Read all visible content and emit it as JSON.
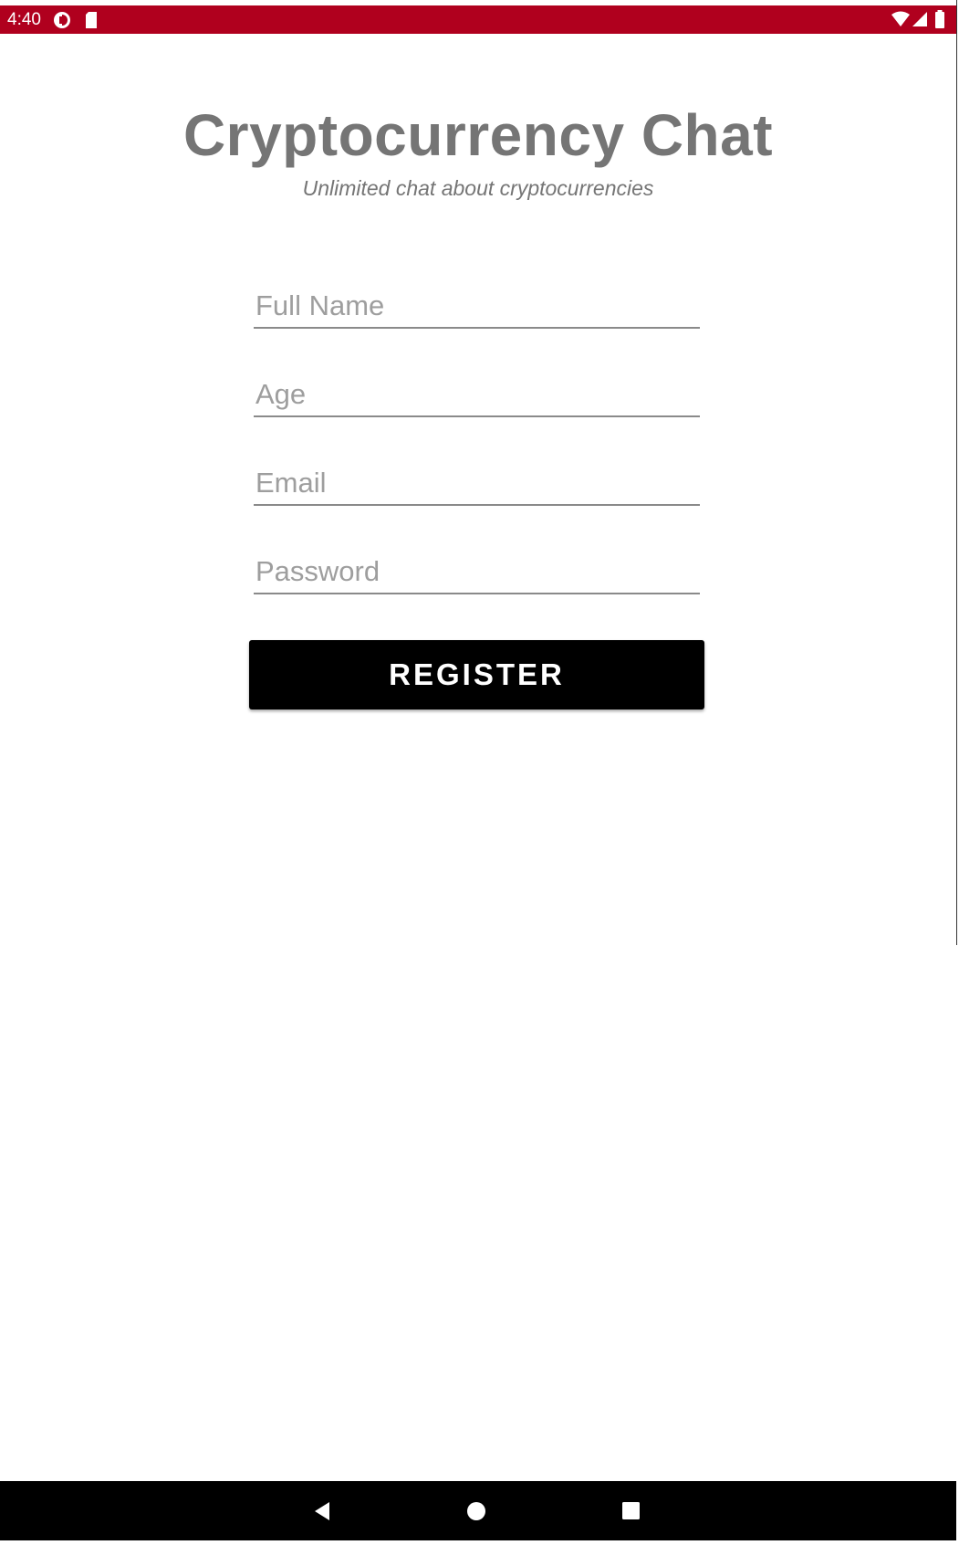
{
  "status_bar": {
    "time": "4:40",
    "left_icons": [
      "data-saver-icon",
      "sd-card-icon"
    ],
    "right_icons": [
      "wifi-icon",
      "cellular-signal-icon",
      "battery-icon"
    ],
    "background_color": "#b0001e"
  },
  "header": {
    "title": "Cryptocurrency Chat",
    "subtitle": "Unlimited chat about cryptocurrencies",
    "text_color": "#757575"
  },
  "form": {
    "full_name": {
      "placeholder": "Full Name",
      "value": ""
    },
    "age": {
      "placeholder": "Age",
      "value": ""
    },
    "email": {
      "placeholder": "Email",
      "value": ""
    },
    "password": {
      "placeholder": "Password",
      "value": ""
    },
    "register_label": "REGISTER"
  },
  "nav_bar": {
    "buttons": [
      "back-icon",
      "home-icon",
      "recents-icon"
    ]
  }
}
